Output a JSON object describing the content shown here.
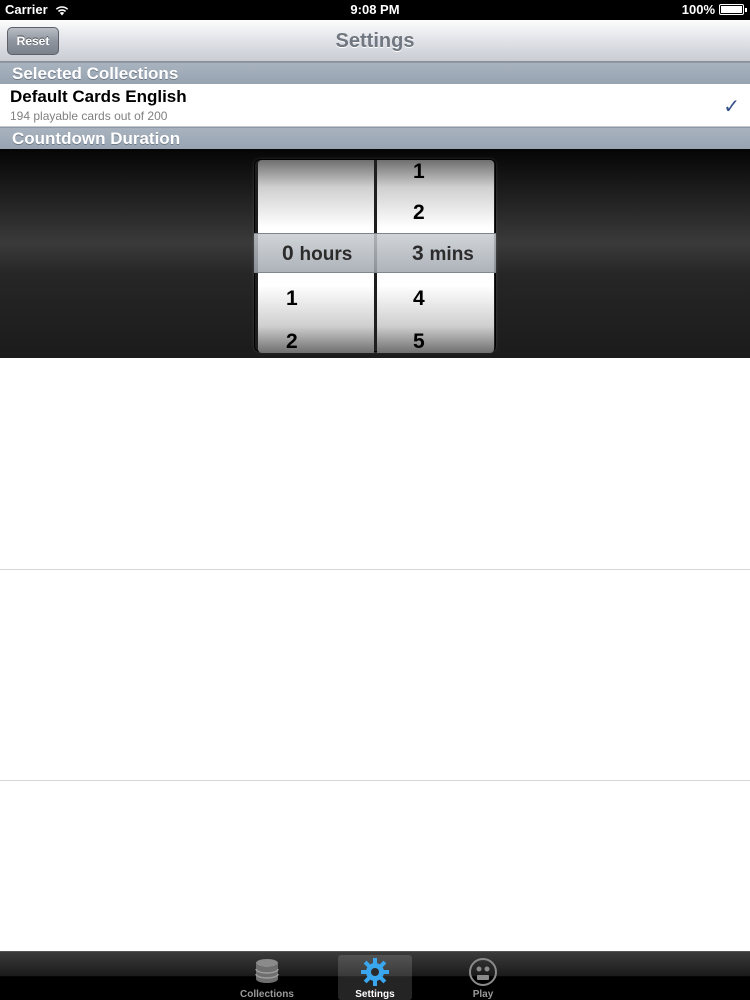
{
  "status_bar": {
    "carrier": "Carrier",
    "time": "9:08 PM",
    "battery": "100%"
  },
  "nav_bar": {
    "title": "Settings",
    "reset_label": "Reset"
  },
  "sections": {
    "collections_header": "Selected Collections",
    "countdown_header": "Countdown Duration"
  },
  "collection": {
    "title": "Default Cards English",
    "subtitle": "194 playable cards out of 200",
    "check": "✓"
  },
  "picker": {
    "hours": {
      "above": [],
      "selected": "0",
      "unit": "hours",
      "below": [
        "1",
        "2"
      ]
    },
    "mins": {
      "above": [
        "1",
        "2"
      ],
      "selected": "3",
      "unit": "mins",
      "below": [
        "4",
        "5"
      ]
    }
  },
  "tab_bar": {
    "tabs": [
      {
        "label": "Collections",
        "icon": "database-icon",
        "selected": false
      },
      {
        "label": "Settings",
        "icon": "gear-icon",
        "selected": true
      },
      {
        "label": "Play",
        "icon": "face-icon",
        "selected": false
      }
    ]
  },
  "colors": {
    "accent_check": "#34508a",
    "section_header": "#9aa6b3",
    "nav_title": "#707780"
  }
}
